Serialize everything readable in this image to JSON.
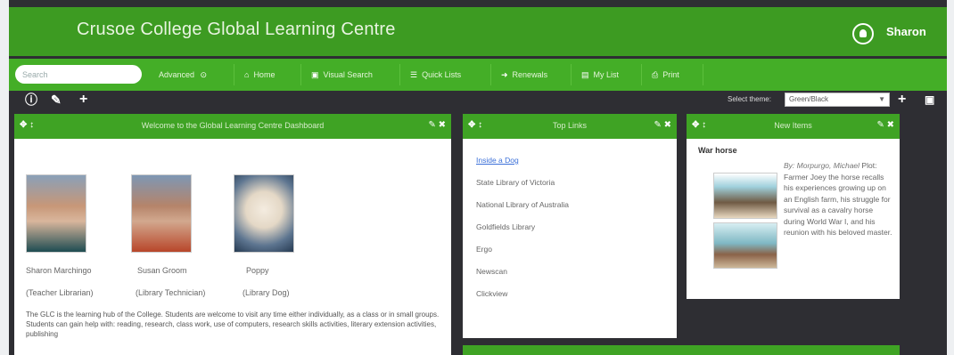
{
  "header": {
    "title": "Crusoe College Global Learning Centre",
    "user": "Sharon"
  },
  "search": {
    "placeholder": "Search"
  },
  "nav": {
    "advanced": "Advanced",
    "home": "Home",
    "visual_search": "Visual Search",
    "quick_lists": "Quick Lists",
    "renewals": "Renewals",
    "my_list": "My List",
    "print": "Print"
  },
  "toolbar": {
    "theme_label": "Select theme:",
    "theme_value": "Green/Black"
  },
  "welcome": {
    "title": "Welcome to the Global Learning Centre Dashboard",
    "staff": [
      {
        "name": "Sharon Marchingo",
        "role": "(Teacher Librarian)"
      },
      {
        "name": "Susan Groom",
        "role": "(Library Technician)"
      },
      {
        "name": "Poppy",
        "role": "(Library Dog)"
      }
    ],
    "intro": "The GLC is the learning hub of the College. Students are welcome to visit any time either individually, as a class or in small groups. Students can gain help with: reading, research, class work, use of computers, research skills activities, literary extension activities, publishing"
  },
  "top_links": {
    "title": "Top Links",
    "items": [
      "Inside a Dog",
      "State Library of Victoria",
      "National Library of Australia",
      "Goldfields Library",
      "Ergo",
      "Newscan",
      "Clickview"
    ]
  },
  "new_items": {
    "title": "New Items",
    "book_title": "War horse",
    "author": "By: Morpurgo, Michael",
    "description": "Plot: Farmer Joey the horse recalls his experiences growing up on an English farm, his struggle for survival as a cavalry horse during World War I, and his reunion with his beloved master."
  },
  "colors": {
    "header": "#3d9b22",
    "nav": "#44ae27",
    "panel_header": "#3fa324",
    "dashboard_bg": "#2e2e33"
  },
  "icons": {
    "user": "user-circle-icon",
    "toolbar": [
      "info-icon",
      "edit-icon",
      "plus-icon"
    ],
    "panel_controls": [
      "move-icon",
      "edit-icon",
      "close-icon"
    ]
  }
}
